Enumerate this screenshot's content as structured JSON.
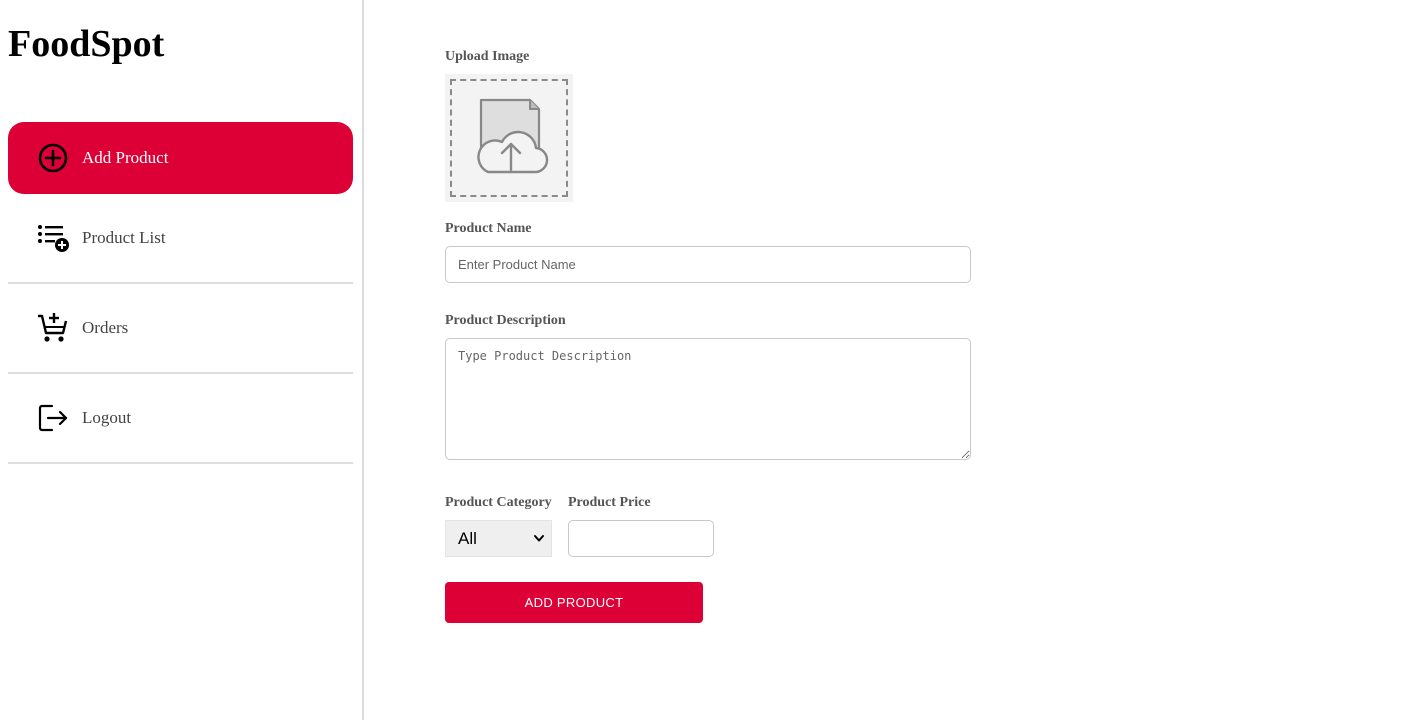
{
  "app": {
    "brand": "FoodSpot"
  },
  "sidebar": {
    "items": [
      {
        "label": "Add Product",
        "icon": "plus-circle-icon",
        "active": true
      },
      {
        "label": "Product List",
        "icon": "list-add-icon",
        "active": false
      },
      {
        "label": "Orders",
        "icon": "cart-add-icon",
        "active": false
      },
      {
        "label": "Logout",
        "icon": "logout-icon",
        "active": false
      }
    ]
  },
  "form": {
    "upload_label": "Upload Image",
    "upload_icon": "cloud-upload-icon",
    "name_label": "Product Name",
    "name_placeholder": "Enter Product Name",
    "description_label": "Product Description",
    "description_placeholder": "Type Product Description",
    "category_label": "Product Category",
    "category_value": "All",
    "price_label": "Product Price",
    "price_value": "",
    "submit_label": "ADD PRODUCT"
  },
  "colors": {
    "accent": "#dc0036",
    "sidebar_border": "#dcdcdc"
  }
}
